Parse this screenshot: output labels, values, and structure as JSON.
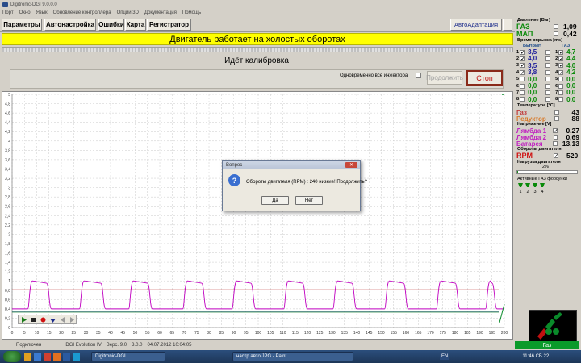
{
  "window": {
    "title": "Digitronic-DGI 9.0.0.0"
  },
  "menu": [
    "Порт",
    "Окно",
    "Язык",
    "Обновление контроллера",
    "Опции 3D",
    "Документация",
    "Помощь"
  ],
  "toolbar": {
    "params": "Параметры",
    "autotune": "Автонастройка",
    "errors": "Ошибки",
    "map": "Карта",
    "recorder": "Регистратор",
    "autoadapt": "АвтоАдаптация"
  },
  "banner": "Двигатель работает на холостых оборотах",
  "calibration": {
    "title": "Идёт калибровка",
    "inj_label": "Одновременно все инжектора",
    "continue": "Продолжить",
    "stop": "Стоп"
  },
  "chart_data": {
    "type": "line",
    "y_ticks": [
      "0",
      "0,2",
      "0,4",
      "0,6",
      "0,8",
      "1",
      "1,2",
      "1,4",
      "1,6",
      "1,8",
      "2",
      "2,2",
      "2,4",
      "2,6",
      "2,8",
      "3",
      "3,2",
      "3,4",
      "3,6",
      "3,8",
      "4",
      "4,2",
      "4,4",
      "4,6",
      "4,8",
      "5"
    ],
    "x_ticks": [
      "0",
      "5",
      "10",
      "15",
      "20",
      "25",
      "30",
      "35",
      "40",
      "45",
      "50",
      "55",
      "60",
      "65",
      "70",
      "75",
      "80",
      "85",
      "90",
      "95",
      "100",
      "105",
      "110",
      "115",
      "120",
      "125",
      "130",
      "135",
      "140",
      "145",
      "150",
      "155",
      "160",
      "165",
      "170",
      "175",
      "180",
      "185",
      "190",
      "195",
      "200"
    ],
    "ylim": [
      0,
      5
    ],
    "xlim": [
      0,
      200
    ],
    "series": [
      {
        "color": "#c000c0",
        "pulse_x": [
          [
            7,
            15
          ],
          [
            28,
            37
          ],
          [
            48,
            56
          ],
          [
            70,
            78
          ],
          [
            90,
            98
          ],
          [
            111,
            119
          ],
          [
            131,
            139
          ],
          [
            152,
            160
          ],
          [
            173,
            181
          ],
          [
            193,
            196
          ]
        ],
        "high": 1.0,
        "low": 0.4
      },
      {
        "color": "#c04040",
        "level": 0.81
      },
      {
        "color": "#2a3ab0",
        "level": 0.35
      },
      {
        "color": "#2a8a40",
        "level": 0.33
      }
    ]
  },
  "right": {
    "pressure": {
      "title": "Давление [Bar]",
      "gas_label": "ГАЗ",
      "gas_val": "1,09",
      "map_label": "МАП",
      "map_val": "0,42"
    },
    "inj": {
      "title": "Время впрыска [ms]",
      "petrol": "БЕНЗИН",
      "gas": "ГАЗ",
      "rows": [
        [
          "1",
          "3,5",
          "1",
          "4,7"
        ],
        [
          "2",
          "4,0",
          "2",
          "4,4"
        ],
        [
          "3",
          "3,5",
          "3",
          "4,0"
        ],
        [
          "4",
          "3,8",
          "4",
          "4,2"
        ],
        [
          "5",
          "0,0",
          "5",
          "0,0"
        ],
        [
          "6",
          "0,0",
          "6",
          "0,0"
        ],
        [
          "7",
          "0,0",
          "7",
          "0,0"
        ],
        [
          "8",
          "0,0",
          "8",
          "0,0"
        ]
      ]
    },
    "temp": {
      "title": "Температура [°C]",
      "gas": "Газ",
      "gas_val": "43",
      "reducer": "Редуктор",
      "reducer_val": "88"
    },
    "volt": {
      "title": "Напряжение [V]",
      "l1": "Лямбда 1",
      "l1_val": "0,27",
      "l2": "Лямбда 2",
      "l2_val": "0,69",
      "bat": "Батарея",
      "bat_val": "13,13"
    },
    "rpm": {
      "title": "Обороты двигателя",
      "label": "RPM",
      "val": "520"
    },
    "load": {
      "title": "Нагрузка двигателя",
      "val": "2%"
    },
    "injectors": {
      "title": "Активные ГАЗ форсунки",
      "nums": [
        "1",
        "2",
        "3",
        "4"
      ]
    },
    "gaz": "Газ"
  },
  "status": {
    "conn": "Подключен",
    "device": "DGI Evolution IV",
    "ver": "Верс. 9.0",
    "ver2": "3.0.0",
    "date": "04.07.2012 10:04:05"
  },
  "taskbar": {
    "app1": "Digitronic-DGI",
    "app2": "настр авто.JPG - Paint",
    "lang": "EN",
    "clock": "11:46 СБ 22"
  },
  "dialog": {
    "title": "Вопрос",
    "message": "Обороты двигателя (RPM) : 240 низкие! Продолжить?",
    "yes": "Да",
    "no": "Нет"
  }
}
